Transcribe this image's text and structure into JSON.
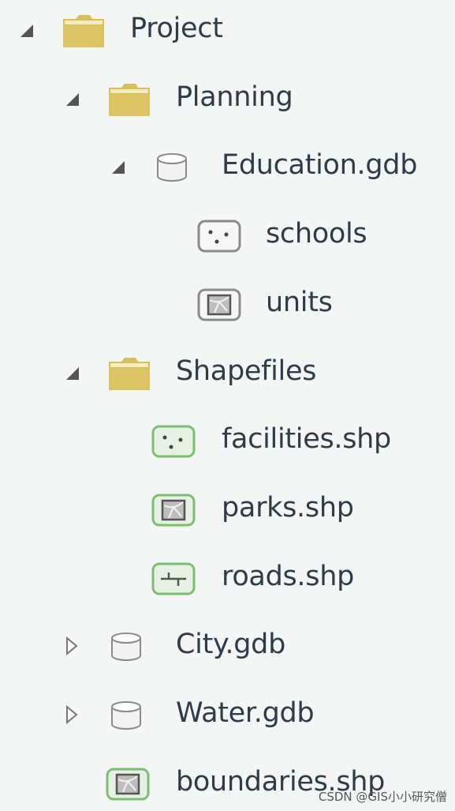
{
  "tree": [
    {
      "label": "Project",
      "level": 0,
      "expander": "expanded",
      "icon": "folder-icon"
    },
    {
      "label": "Planning",
      "level": 1,
      "expander": "expanded",
      "icon": "folder-icon"
    },
    {
      "label": "Education.gdb",
      "level": 2,
      "expander": "expanded",
      "icon": "geodatabase-icon"
    },
    {
      "label": "schools",
      "level": 3,
      "expander": "none",
      "icon": "point-feature-class-icon"
    },
    {
      "label": "units",
      "level": 3,
      "expander": "none",
      "icon": "polygon-feature-class-icon"
    },
    {
      "label": "Shapefiles",
      "level": 1,
      "expander": "expanded",
      "icon": "folder-icon"
    },
    {
      "label": "facilities.shp",
      "level": 2,
      "expander": "none",
      "icon": "point-shapefile-icon"
    },
    {
      "label": "parks.shp",
      "level": 2,
      "expander": "none",
      "icon": "polygon-shapefile-icon"
    },
    {
      "label": "roads.shp",
      "level": 2,
      "expander": "none",
      "icon": "line-shapefile-icon"
    },
    {
      "label": "City.gdb",
      "level": 1,
      "expander": "collapsed",
      "icon": "geodatabase-icon"
    },
    {
      "label": "Water.gdb",
      "level": 1,
      "expander": "collapsed",
      "icon": "geodatabase-icon"
    },
    {
      "label": "boundaries.shp",
      "level": 1,
      "expander": "none",
      "icon": "polygon-shapefile-icon"
    }
  ],
  "watermark": "CSDN @GIS小小研究僧",
  "colors": {
    "folder": "#d9bf5a",
    "shapefile_border": "#7dbd72",
    "text": "#2f3b47",
    "background": "#f4f6f6"
  }
}
